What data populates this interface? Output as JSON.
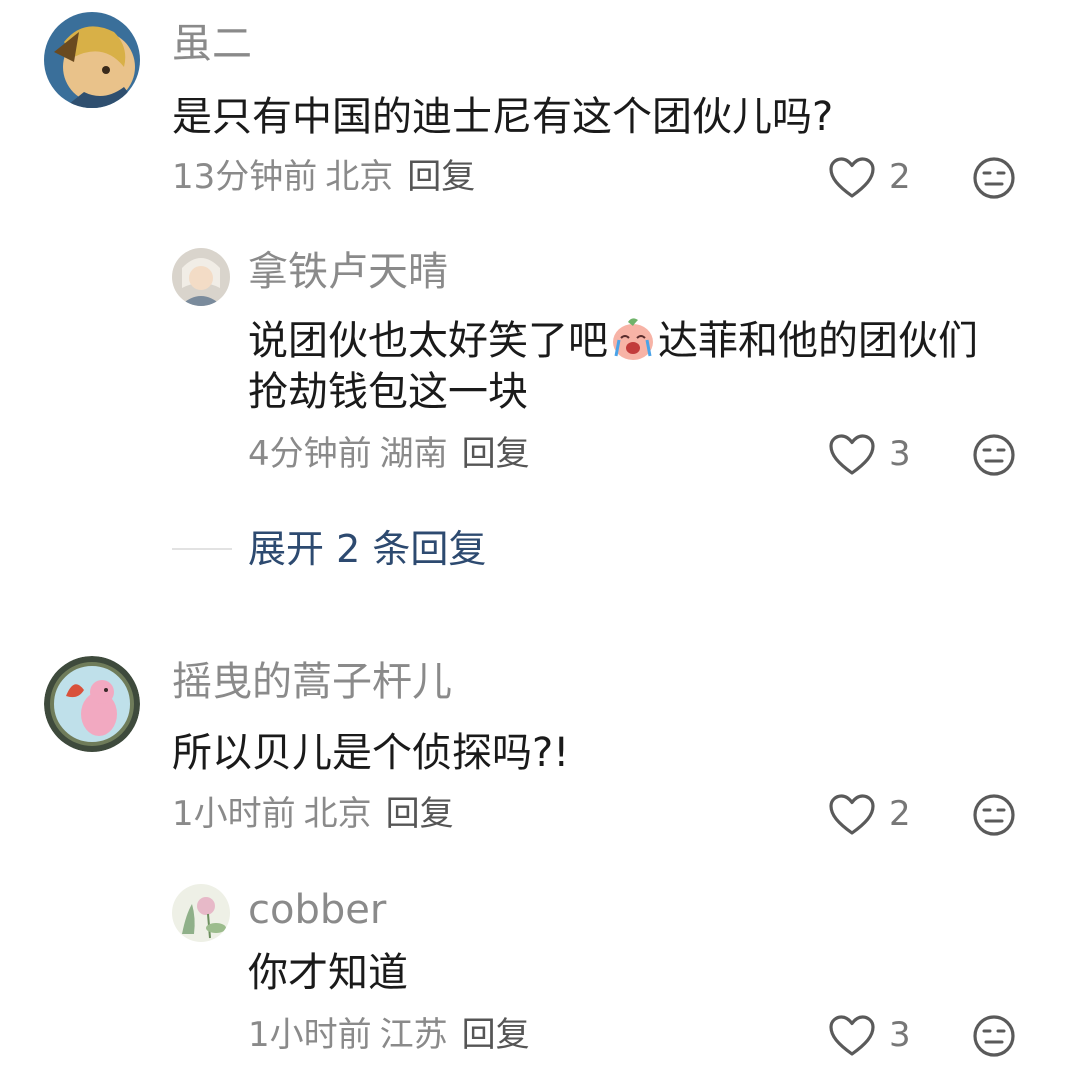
{
  "comments": [
    {
      "user": "虽二",
      "text": "是只有中国的迪士尼有这个团伙儿吗?",
      "time": "13分钟前",
      "location": "北京",
      "reply_label": "回复",
      "likes": "2",
      "replies": [
        {
          "user": "拿铁卢天晴",
          "text_part1": "说团伙也太好笑了吧",
          "text_part2": "达菲和他的团伙们",
          "text_line2": "抢劫钱包这一块",
          "emoji": "crying-laughing-peach-emoji",
          "time": "4分钟前",
          "location": "湖南",
          "reply_label": "回复",
          "likes": "3"
        }
      ],
      "expand_label": "展开 2 条回复"
    },
    {
      "user": "摇曳的蒿子杆儿",
      "text": "所以贝儿是个侦探吗?!",
      "time": "1小时前",
      "location": "北京",
      "reply_label": "回复",
      "likes": "2",
      "replies": [
        {
          "user": "cobber",
          "text": "你才知道",
          "time": "1小时前",
          "location": "江苏",
          "reply_label": "回复",
          "likes": "3"
        }
      ]
    }
  ],
  "icons": {
    "like": "heart-outline-icon",
    "dislike": "neutral-face-icon"
  },
  "colors": {
    "name": "#8a8a8a",
    "text": "#1a1a1a",
    "meta": "#8a8a8a",
    "expand": "#2d4a70"
  }
}
